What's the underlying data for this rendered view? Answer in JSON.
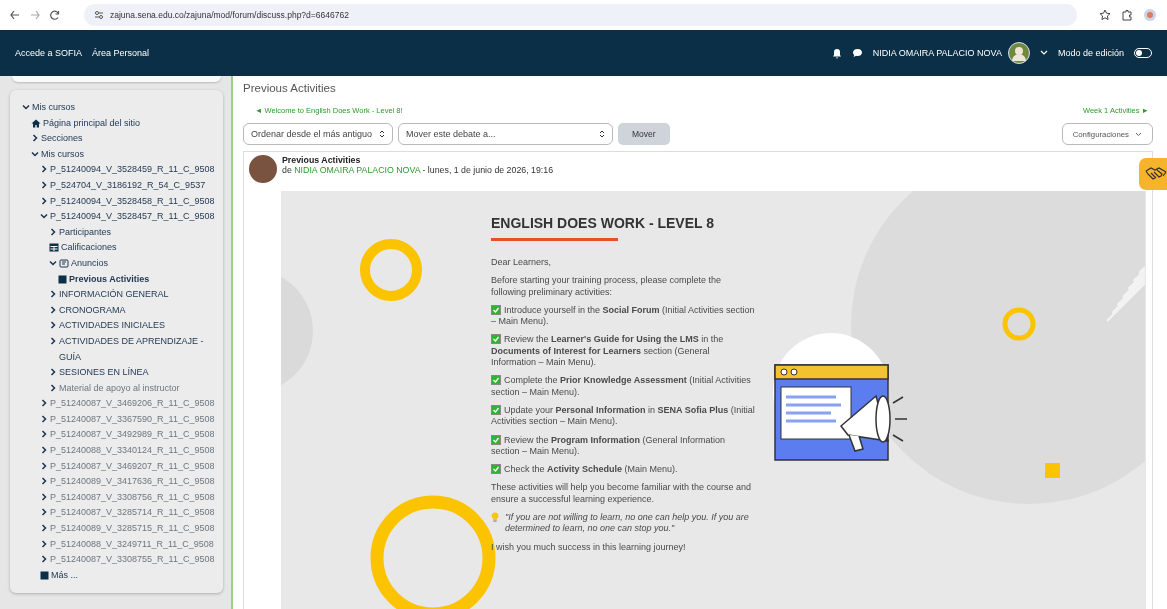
{
  "browser": {
    "url": "zajuna.sena.edu.co/zajuna/mod/forum/discuss.php?d=6646762"
  },
  "navbar": {
    "links": [
      "Accede a SOFIA",
      "Área Personal"
    ],
    "user": "NIDIA OMAIRA PALACIO NOVA",
    "edit_mode": {
      "label": "Modo de edición",
      "on": false
    }
  },
  "sidebar": {
    "tree": [
      {
        "label": "Mis cursos",
        "kind": "branch",
        "expanded": true,
        "dimmed": false,
        "children": [
          {
            "label": "Página principal del sitio",
            "kind": "home",
            "dimmed": false
          },
          {
            "label": "Secciones",
            "kind": "branch",
            "expanded": false,
            "dimmed": false
          },
          {
            "label": "Mis cursos",
            "kind": "branch",
            "expanded": true,
            "dimmed": false,
            "children": [
              {
                "label": "P_51240094_V_3528459_R_11_C_9508",
                "kind": "branch",
                "expanded": false,
                "dimmed": false
              },
              {
                "label": "P_524704_V_3186192_R_54_C_9537",
                "kind": "branch",
                "expanded": false,
                "dimmed": false
              },
              {
                "label": "P_51240094_V_3528458_R_11_C_9508",
                "kind": "branch",
                "expanded": false,
                "dimmed": false
              },
              {
                "label": "P_51240094_V_3528457_R_11_C_9508",
                "kind": "branch",
                "expanded": true,
                "dimmed": false,
                "children": [
                  {
                    "label": "Participantes",
                    "kind": "branch",
                    "expanded": false,
                    "dimmed": false
                  },
                  {
                    "label": "Calificaciones",
                    "kind": "grades",
                    "dimmed": false
                  },
                  {
                    "label": "Anuncios",
                    "kind": "forum",
                    "expanded": true,
                    "dimmed": false,
                    "children": [
                      {
                        "label": "Previous Activities",
                        "kind": "current",
                        "dimmed": false
                      }
                    ]
                  },
                  {
                    "label": "INFORMACIÓN GENERAL",
                    "kind": "branch",
                    "expanded": false,
                    "dimmed": false
                  },
                  {
                    "label": "CRONOGRAMA",
                    "kind": "branch",
                    "expanded": false,
                    "dimmed": false
                  },
                  {
                    "label": "ACTIVIDADES INICIALES",
                    "kind": "branch",
                    "expanded": false,
                    "dimmed": false
                  },
                  {
                    "label": "ACTIVIDADES DE APRENDIZAJE - GUÍA",
                    "kind": "branch",
                    "expanded": false,
                    "dimmed": false
                  },
                  {
                    "label": "SESIONES EN LÍNEA",
                    "kind": "branch",
                    "expanded": false,
                    "dimmed": false
                  },
                  {
                    "label": "Material de apoyo al instructor",
                    "kind": "branch",
                    "expanded": false,
                    "dimmed": true
                  }
                ]
              },
              {
                "label": "P_51240087_V_3469206_R_11_C_9508",
                "kind": "branch",
                "expanded": false,
                "dimmed": true
              },
              {
                "label": "P_51240087_V_3367590_R_11_C_9508",
                "kind": "branch",
                "expanded": false,
                "dimmed": true
              },
              {
                "label": "P_51240087_V_3492989_R_11_C_9508",
                "kind": "branch",
                "expanded": false,
                "dimmed": true
              },
              {
                "label": "P_51240088_V_3340124_R_11_C_9508",
                "kind": "branch",
                "expanded": false,
                "dimmed": true
              },
              {
                "label": "P_51240087_V_3469207_R_11_C_9508",
                "kind": "branch",
                "expanded": false,
                "dimmed": true
              },
              {
                "label": "P_51240089_V_3417636_R_11_C_9508",
                "kind": "branch",
                "expanded": false,
                "dimmed": true
              },
              {
                "label": "P_51240087_V_3308756_R_11_C_9508",
                "kind": "branch",
                "expanded": false,
                "dimmed": true
              },
              {
                "label": "P_51240087_V_3285714_R_11_C_9508",
                "kind": "branch",
                "expanded": false,
                "dimmed": true
              },
              {
                "label": "P_51240089_V_3285715_R_11_C_9508",
                "kind": "branch",
                "expanded": false,
                "dimmed": true
              },
              {
                "label": "P_51240088_V_3249711_R_11_C_9508",
                "kind": "branch",
                "expanded": false,
                "dimmed": true
              },
              {
                "label": "P_51240087_V_3308755_R_11_C_9508",
                "kind": "branch",
                "expanded": false,
                "dimmed": true
              },
              {
                "label": "Más ...",
                "kind": "more",
                "dimmed": false
              }
            ]
          }
        ]
      }
    ]
  },
  "forum": {
    "title": "Previous Activities",
    "prev_link": "◄ Welcome to English Does Work - Level 8!",
    "next_link": "Week 1 Activities ►",
    "sort_select": "Ordenar desde el más antiguo",
    "move_select": "Mover este debate a...",
    "move_button": "Mover",
    "settings_button": "Configuraciones",
    "post": {
      "subject": "Previous Activities",
      "by": "de",
      "author": "NIDIA OMAIRA PALACIO NOVA",
      "meta": "- lunes, 1 de junio de 2026, 19:16",
      "content": {
        "heading": "ENGLISH DOES WORK - LEVEL 8",
        "intro": [
          "Dear Learners,",
          "Before starting your training process, please complete the following preliminary activities:"
        ],
        "checklist": [
          {
            "text": "Introduce yourself in the **Social Forum** (Initial Activities section – Main Menu).",
            "checked": true
          },
          {
            "text": "Review the **Learner's Guide for Using the LMS** in the **Documents of Interest for Learners** section (General Information – Main Menu).",
            "checked": true
          },
          {
            "text": "Complete the **Prior Knowledge Assessment** (Initial Activities section – Main Menu).",
            "checked": true
          },
          {
            "text": "Update your **Personal Information** in **SENA Sofia Plus** (Initial Activities section – Main Menu).",
            "checked": true
          },
          {
            "text": "Review the **Program Information** (General Information section – Main Menu).",
            "checked": true
          },
          {
            "text": "Check the **Activity Schedule** (Main Menu).",
            "checked": true
          }
        ],
        "closing": "These activities will help you become familiar with the course and ensure a successful learning experience.",
        "quote": "\"If you are not willing to learn, no one can help you. If you are determined to learn, no one can stop you.\"",
        "farewell": "I wish you much success in this learning journey!"
      }
    }
  }
}
